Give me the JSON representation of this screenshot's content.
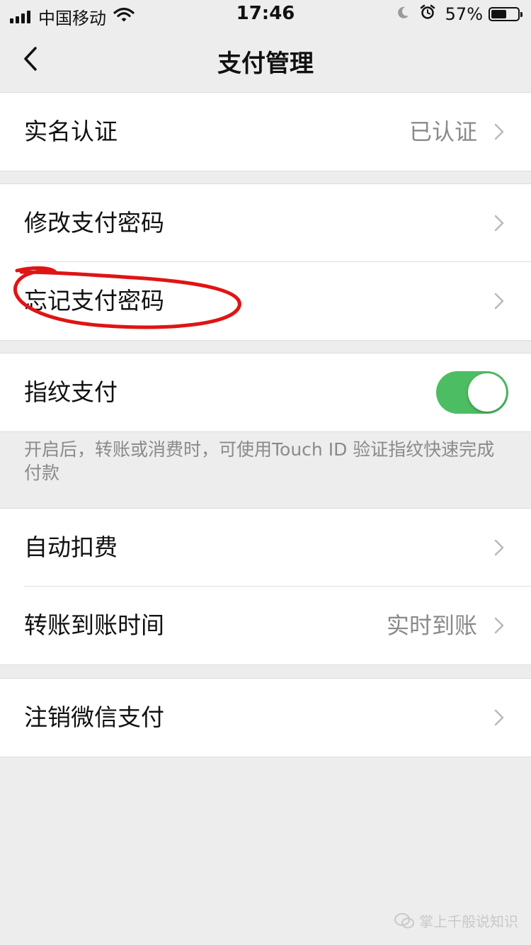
{
  "status_bar": {
    "carrier": "中国移动",
    "time": "17:46",
    "battery_percent": "57%",
    "battery_level": 0.57,
    "icons": [
      "signal-icon",
      "wifi-icon",
      "moon-icon",
      "alarm-icon",
      "battery-icon"
    ]
  },
  "nav": {
    "title": "支付管理",
    "back_icon": "chevron-left-icon"
  },
  "groups": {
    "identity": {
      "label": "实名认证",
      "value": "已认证"
    },
    "password": {
      "change_label": "修改支付密码",
      "forgot_label": "忘记支付密码"
    },
    "fingerprint": {
      "label": "指纹支付",
      "enabled": true,
      "hint": "开启后，转账或消费时，可使用Touch ID 验证指纹快速完成付款"
    },
    "payments": {
      "auto_deduct_label": "自动扣费",
      "transfer_time_label": "转账到账时间",
      "transfer_time_value": "实时到账"
    },
    "deactivate": {
      "label": "注销微信支付"
    }
  },
  "colors": {
    "toggle_on": "#4cbd63",
    "annotation": "#e01414",
    "background": "#ededed"
  },
  "watermark": {
    "text": "掌上千般说知识"
  }
}
